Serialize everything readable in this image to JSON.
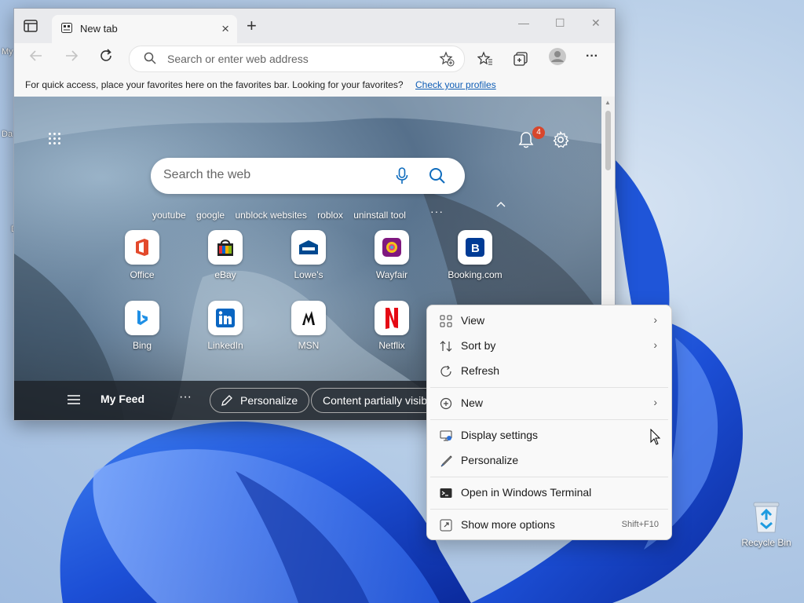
{
  "desktop": {
    "edge_labels": [
      "My",
      "Da",
      "D"
    ],
    "recycle_bin_label": "Recycle Bin"
  },
  "browser": {
    "tab_title": "New tab",
    "tab_close": "×",
    "new_tab": "+",
    "window_controls": {
      "minimize": "—",
      "maximize": "☐",
      "close": "✕"
    },
    "address_placeholder": "Search or enter web address",
    "more_menu": "···",
    "favorites_bar": {
      "message": "For quick access, place your favorites here on the favorites bar. Looking for your favorites?",
      "link": "Check your profiles"
    },
    "newtab_page": {
      "notification_count": "4",
      "search_placeholder": "Search the web",
      "quick_links": [
        "youtube",
        "google",
        "unblock websites",
        "roblox",
        "uninstall tool"
      ],
      "quick_links_more": "···",
      "tiles_row1": [
        {
          "label": "Office",
          "icon": "office-icon"
        },
        {
          "label": "eBay",
          "icon": "ebay-icon"
        },
        {
          "label": "Lowe's",
          "icon": "lowes-icon"
        },
        {
          "label": "Wayfair",
          "icon": "wayfair-icon"
        },
        {
          "label": "Booking.com",
          "icon": "booking-icon"
        }
      ],
      "tiles_row2": [
        {
          "label": "Bing",
          "icon": "bing-icon"
        },
        {
          "label": "LinkedIn",
          "icon": "linkedin-icon"
        },
        {
          "label": "MSN",
          "icon": "msn-icon"
        },
        {
          "label": "Netflix",
          "icon": "netflix-icon"
        }
      ],
      "feed": {
        "my_feed": "My Feed",
        "dots": "···",
        "personalize": "Personalize",
        "content_visibility": "Content partially visible"
      }
    }
  },
  "context_menu": {
    "items": [
      {
        "label": "View",
        "icon": "view-grid-icon",
        "submenu": "›"
      },
      {
        "label": "Sort by",
        "icon": "sort-icon",
        "submenu": "›"
      },
      {
        "label": "Refresh",
        "icon": "refresh-icon"
      },
      {
        "label": "New",
        "icon": "new-plus-icon",
        "submenu": "›"
      },
      {
        "label": "Display settings",
        "icon": "display-settings-icon"
      },
      {
        "label": "Personalize",
        "icon": "brush-icon"
      },
      {
        "label": "Open in Windows Terminal",
        "icon": "terminal-icon"
      },
      {
        "label": "Show more options",
        "icon": "more-options-icon",
        "shortcut": "Shift+F10"
      }
    ]
  }
}
